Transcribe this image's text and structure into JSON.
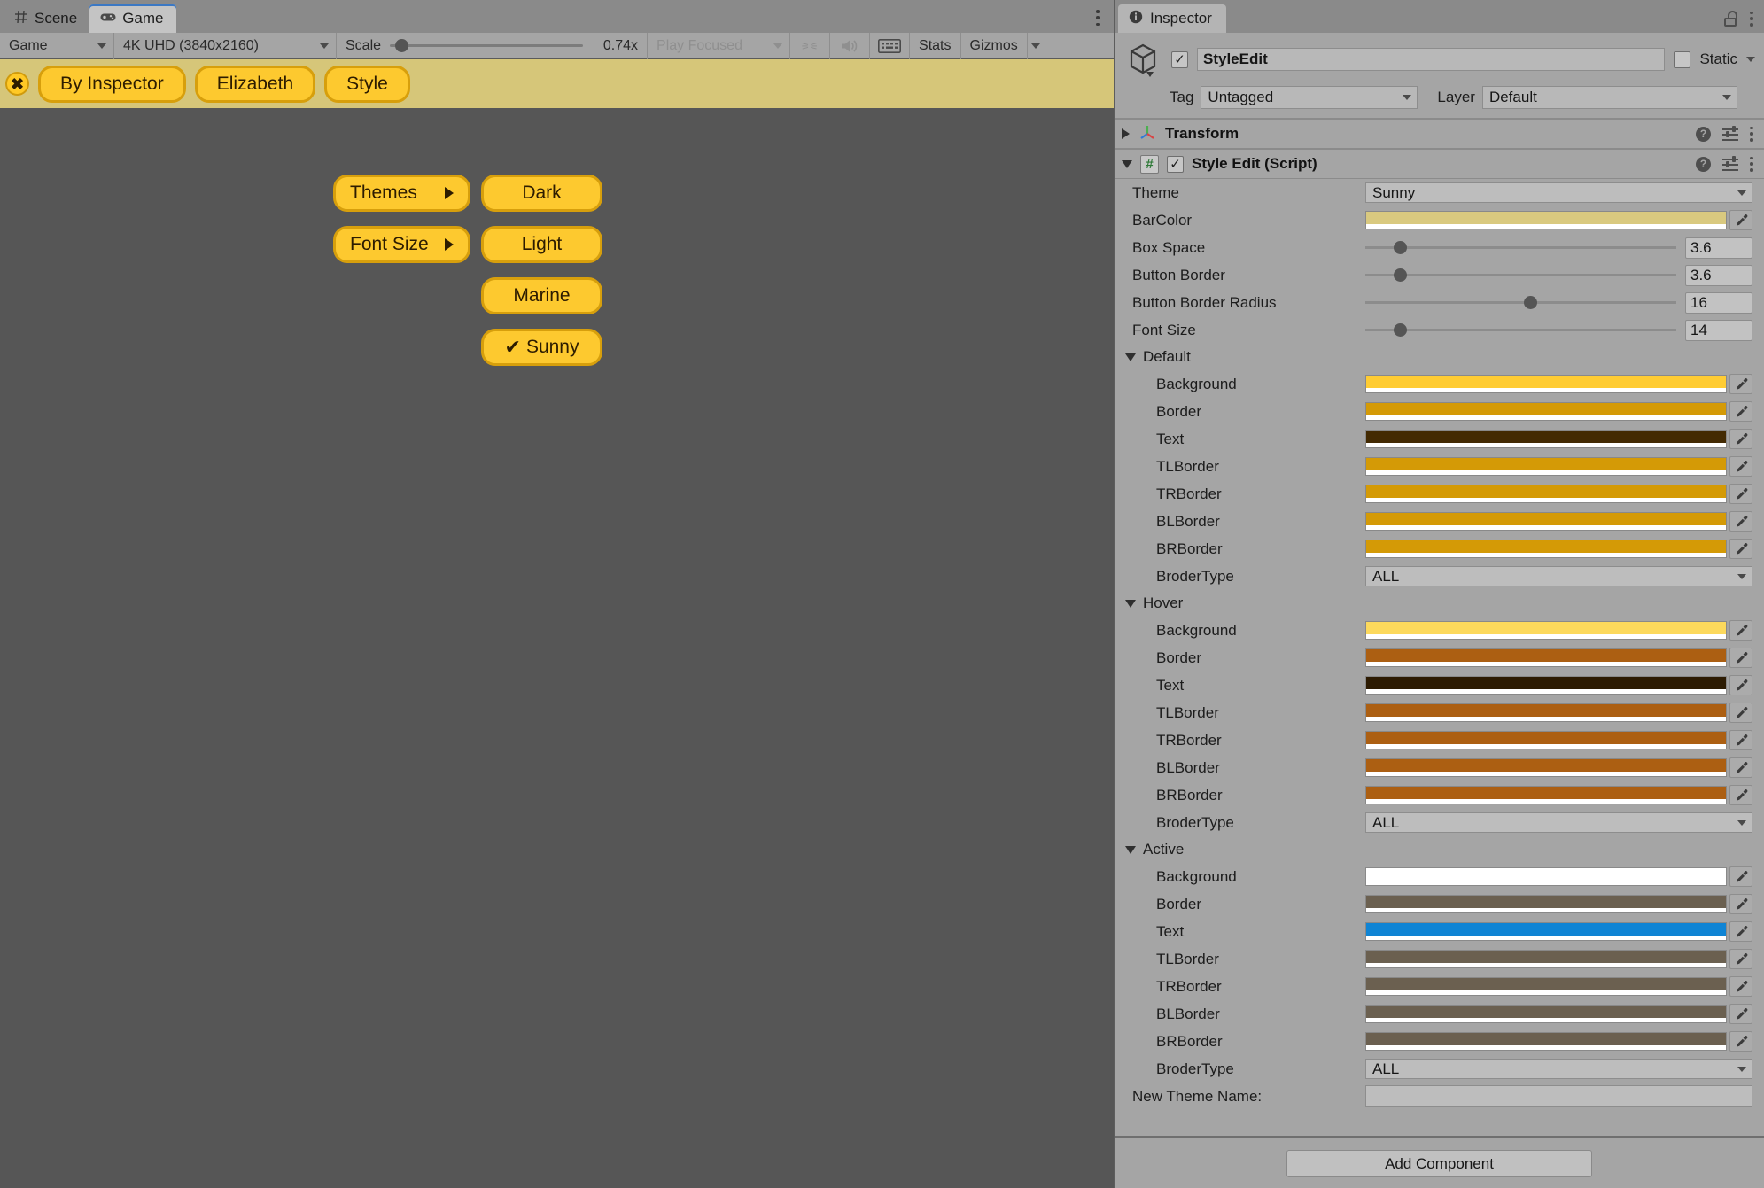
{
  "window": {
    "left_tabs": [
      {
        "label": "Scene",
        "icon": "grid-icon",
        "active": false
      },
      {
        "label": "Game",
        "icon": "gamepad-icon",
        "active": true
      }
    ],
    "right_tabs": [
      {
        "label": "Inspector",
        "icon": "info-icon",
        "active": true
      }
    ]
  },
  "game_toolbar": {
    "display_select": "Game",
    "resolution_select": "4K UHD (3840x2160)",
    "scale_label": "Scale",
    "scale_value": "0.74x",
    "scale_percent": 6,
    "aspect_select": "Play Focused",
    "mute_icon": "speaker-icon",
    "keyboard_icon": "keyboard-icon",
    "stats_label": "Stats",
    "gizmos_label": "Gizmos"
  },
  "game_view": {
    "menubar": {
      "close_icon": "close-x-icon",
      "buttons": [
        {
          "label": "By Inspector"
        },
        {
          "label": "Elizabeth"
        },
        {
          "label": "Style"
        }
      ]
    },
    "menu_column_left": [
      {
        "label": "Themes",
        "submenu": true
      },
      {
        "label": "Font Size",
        "submenu": true
      }
    ],
    "menu_column_right": [
      {
        "label": "Dark",
        "checked": false
      },
      {
        "label": "Light",
        "checked": false
      },
      {
        "label": "Marine",
        "checked": false
      },
      {
        "label": "Sunny",
        "checked": true
      }
    ],
    "colors": {
      "bar": "#d6c679",
      "button_bg": "#fdc92f",
      "button_border": "#d79f0c",
      "button_text": "#2d1c00",
      "backdrop": "#565656"
    }
  },
  "inspector": {
    "title": "Inspector",
    "lock_icon": "lock-open-icon",
    "menu_icon": "kebab-menu-icon",
    "object": {
      "icon": "cube-icon",
      "enabled": true,
      "name": "StyleEdit",
      "static_label": "Static",
      "static_checked": false,
      "tag_label": "Tag",
      "tag_value": "Untagged",
      "layer_label": "Layer",
      "layer_value": "Default"
    },
    "components": [
      {
        "name": "Transform",
        "expanded": false,
        "icon": "transform-axis-icon",
        "has_enable_toggle": false
      },
      {
        "name": "Style Edit (Script)",
        "expanded": true,
        "icon": "script-icon",
        "has_enable_toggle": true,
        "enabled": true
      }
    ],
    "style_edit": {
      "theme": {
        "label": "Theme",
        "value": "Sunny"
      },
      "bar_color": {
        "label": "BarColor",
        "color": "#d9c97f"
      },
      "sliders": [
        {
          "label": "Box Space",
          "value": "3.6",
          "percent": 11
        },
        {
          "label": "Button Border",
          "value": "3.6",
          "percent": 11
        },
        {
          "label": "Button Border Radius",
          "value": "16",
          "percent": 53
        },
        {
          "label": "Font Size",
          "value": "14",
          "percent": 11
        }
      ],
      "sections": [
        {
          "name": "Default",
          "colors": [
            {
              "label": "Background",
              "color": "#ffcc33"
            },
            {
              "label": "Border",
              "color": "#d49a06"
            },
            {
              "label": "Text",
              "color": "#432a02"
            },
            {
              "label": "TLBorder",
              "color": "#d49a06"
            },
            {
              "label": "TRBorder",
              "color": "#d49a06"
            },
            {
              "label": "BLBorder",
              "color": "#d49a06"
            },
            {
              "label": "BRBorder",
              "color": "#d49a06"
            }
          ],
          "border_type": {
            "label": "BroderType",
            "value": "ALL"
          }
        },
        {
          "name": "Hover",
          "colors": [
            {
              "label": "Background",
              "color": "#fcd95c"
            },
            {
              "label": "Border",
              "color": "#ac5f12"
            },
            {
              "label": "Text",
              "color": "#2d1b02"
            },
            {
              "label": "TLBorder",
              "color": "#ac5f12"
            },
            {
              "label": "TRBorder",
              "color": "#ac5f12"
            },
            {
              "label": "BLBorder",
              "color": "#ac5f12"
            },
            {
              "label": "BRBorder",
              "color": "#ac5f12"
            }
          ],
          "border_type": {
            "label": "BroderType",
            "value": "ALL"
          }
        },
        {
          "name": "Active",
          "colors": [
            {
              "label": "Background",
              "color": "#ffffff"
            },
            {
              "label": "Border",
              "color": "#6b6050"
            },
            {
              "label": "Text",
              "color": "#0f84d4"
            },
            {
              "label": "TLBorder",
              "color": "#6b6050"
            },
            {
              "label": "TRBorder",
              "color": "#6b6050"
            },
            {
              "label": "BLBorder",
              "color": "#6b6050"
            },
            {
              "label": "BRBorder",
              "color": "#6b6050"
            }
          ],
          "border_type": {
            "label": "BroderType",
            "value": "ALL"
          }
        }
      ],
      "new_theme": {
        "label": "New Theme Name:",
        "value": "",
        "placeholder": ""
      }
    },
    "add_component_label": "Add Component"
  }
}
